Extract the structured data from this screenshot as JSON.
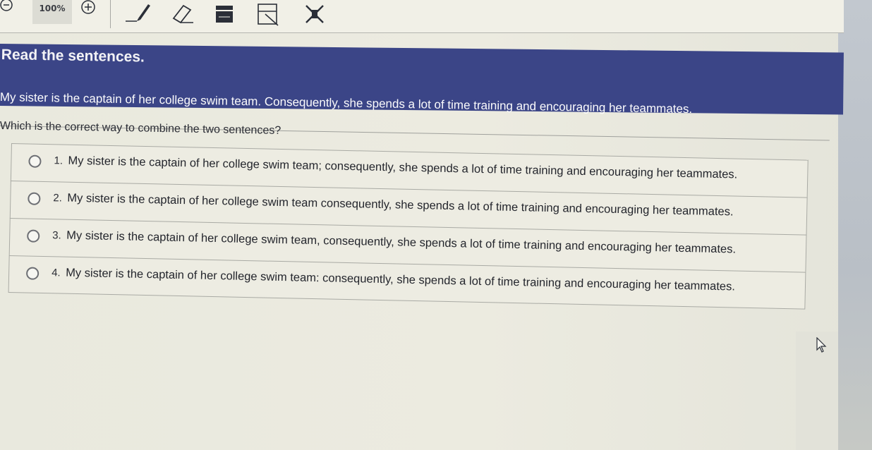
{
  "toolbar": {
    "zoom_value": "100%",
    "tools": [
      "zoom-out-icon",
      "zoom-in-icon",
      "pen-icon",
      "eraser-icon",
      "highlighter-icon",
      "line-reader-icon",
      "masking-icon"
    ]
  },
  "colors": {
    "header_band": "#3b4587",
    "page_background": "#ecebe0",
    "text": "#24262d"
  },
  "prompt": {
    "title": "Read the sentences.",
    "passage": "My sister is the captain of her college swim team. Consequently, she spends a lot of time training and encouraging her teammates.",
    "question": "Which is the correct way to combine the two sentences?"
  },
  "options": [
    {
      "number": "1.",
      "text": "My sister is the captain of her college swim team; consequently, she spends a lot of time training and encouraging her teammates."
    },
    {
      "number": "2.",
      "text": "My sister is the captain of her college swim team consequently, she spends a lot of time training and encouraging her teammates."
    },
    {
      "number": "3.",
      "text": "My sister is the captain of her college swim team, consequently, she spends a lot of time training and encouraging her teammates."
    },
    {
      "number": "4.",
      "text": "My sister is the captain of her college swim team: consequently, she spends a lot of time training and encouraging her teammates."
    }
  ]
}
